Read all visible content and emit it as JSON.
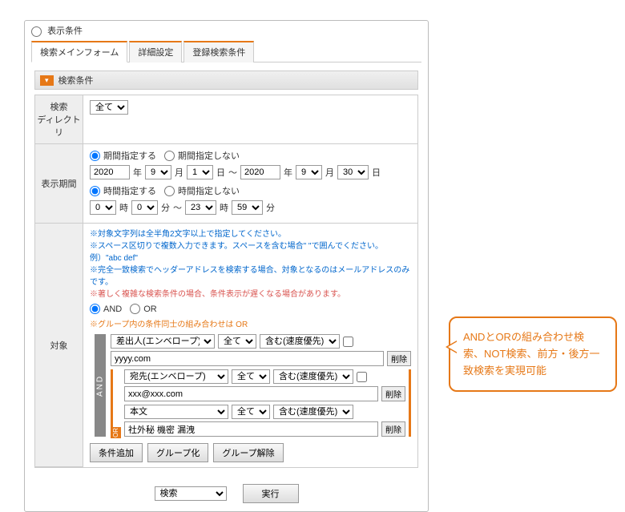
{
  "panel": {
    "title": "表示条件"
  },
  "tabs": {
    "main": "検索メインフォーム",
    "advanced": "詳細設定",
    "saved": "登録検索条件"
  },
  "section": {
    "search_conditions": "検索条件"
  },
  "dir": {
    "label": "検索\nディレクト\nリ",
    "value": "全て"
  },
  "period": {
    "label": "表示期間",
    "spec_yes": "期間指定する",
    "spec_no": "期間指定しない",
    "from_year": "2020",
    "from_month": "9",
    "from_day": "1",
    "to_year": "2020",
    "to_month": "9",
    "to_day": "30",
    "year_u": "年",
    "month_u": "月",
    "day_u": "日",
    "tilde": "～",
    "time_yes": "時間指定する",
    "time_no": "時間指定しない",
    "from_h": "0",
    "from_m": "0",
    "to_h": "23",
    "to_m": "59",
    "hour_u": "時",
    "min_u": "分"
  },
  "target": {
    "label": "対象",
    "note1": "※対象文字列は全半角2文字以上で指定してください。",
    "note2": "※スペース区切りで複数入力できます。スペースを含む場合\" \"で囲んでください。",
    "note3": "例）\"abc def\"",
    "note4": "※完全一致検索でヘッダーアドレスを検索する場合、対象となるのはメールアドレスのみです。",
    "note5": "※著しく複雑な検索条件の場合、条件表示が遅くなる場合があります。",
    "and": "AND",
    "or": "OR",
    "group_note": "※グループ内の条件同士の組み合わせは OR",
    "and_bar": "AND",
    "or_badge": "OR",
    "scope_all": "全て",
    "match_contains": "含む(速度優先)",
    "c1_field": "差出人(エンベロープ)",
    "c1_value": "yyyy.com",
    "c2_field": "宛先(エンベロープ)",
    "c2_value": "xxx@xxx.com",
    "c3_field": "本文",
    "c3_value": "社外秘 機密 漏洩",
    "delete": "削除",
    "add_cond": "条件追加",
    "group": "グループ化",
    "ungroup": "グループ解除"
  },
  "bottom": {
    "mode": "検索",
    "run": "実行"
  },
  "callout": {
    "text": "ANDとORの組み合わせ検索、NOT検索、前方・後方一致検索を実現可能"
  }
}
